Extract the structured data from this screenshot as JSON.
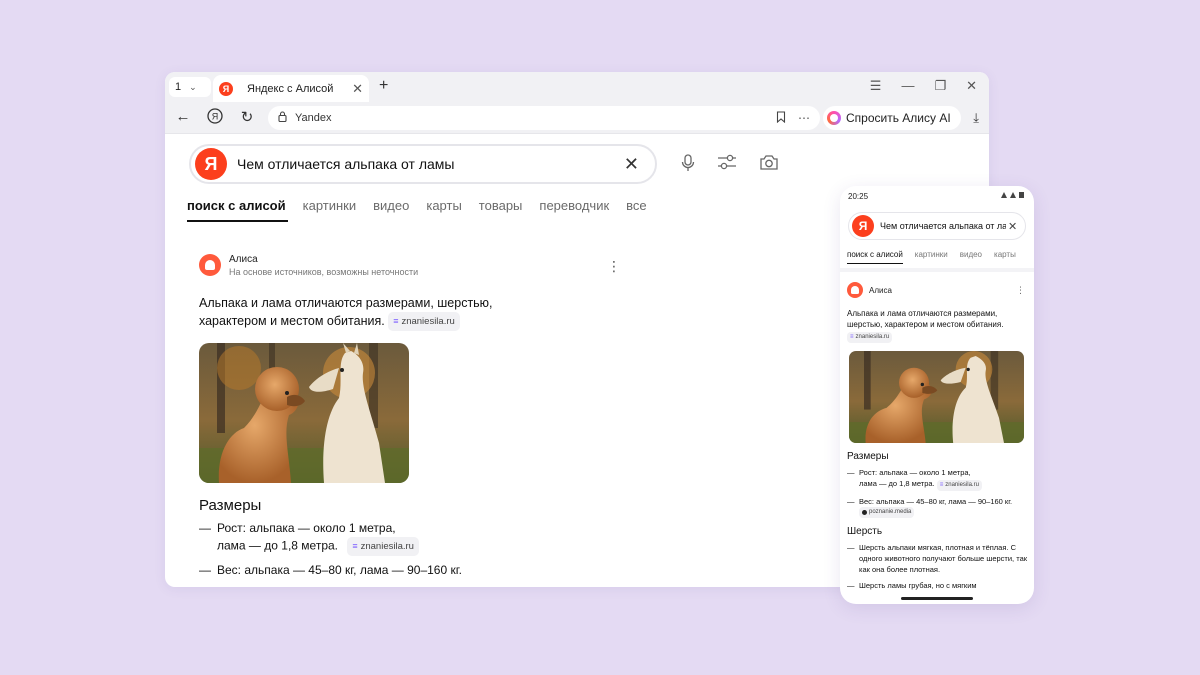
{
  "browser": {
    "tab_count": "1",
    "tab_title": "Яндекс с Алисой",
    "ylogo_letter": "Я",
    "address": "Yandex",
    "alice_button": "Спросить Алису AI"
  },
  "search": {
    "query": "Чем отличается альпака от ламы",
    "tabs": [
      "поиск с алисой",
      "картинки",
      "видео",
      "карты",
      "товары",
      "переводчик",
      "все"
    ]
  },
  "answer": {
    "source_name": "Алиса",
    "source_note": "На основе источников, возможны неточности",
    "lead": "Альпака и лама отличаются размерами, шерстью, характером и местом обитания.",
    "lead_source": "znaniesila.ru",
    "section_title": "Размеры",
    "items": [
      {
        "text_1": "Рост: альпака — около 1 метра,",
        "text_2": "лама — до 1,8 метра.",
        "source": "znaniesila.ru"
      },
      {
        "text_1": "Вес: альпака — 45–80 кг, лама — 90–160 кг."
      }
    ]
  },
  "phone": {
    "time": "20:25",
    "query": "Чем отличается альпака от ламы",
    "tabs": [
      "поиск с алисой",
      "картинки",
      "видео",
      "карты"
    ],
    "source_name": "Алиса",
    "lead": "Альпака и лама отличаются размерами, шерстью, характером и местом обитания.",
    "lead_source": "znaniesila.ru",
    "section_1": "Размеры",
    "sizes": [
      {
        "text_1": "Рост: альпака — около 1 метра,",
        "text_2": "лама — до 1,8 метра.",
        "source": "znaniesila.ru"
      },
      {
        "text_1": "Вес: альпака — 45–80 кг, лама — 90–160 кг.",
        "source": "poznanie.media"
      }
    ],
    "section_2": "Шерсть",
    "wool": [
      {
        "text": "Шерсть альпаки мягкая, плотная и тёплая. С одного животного получают больше шерсти, так как она более плотная."
      },
      {
        "text": "Шерсть ламы грубая, но с мягким"
      }
    ]
  },
  "colors": {
    "yandex_red": "#fc3f1d",
    "alice_orange": "#ff5a3c",
    "background": "#e4daf3"
  }
}
